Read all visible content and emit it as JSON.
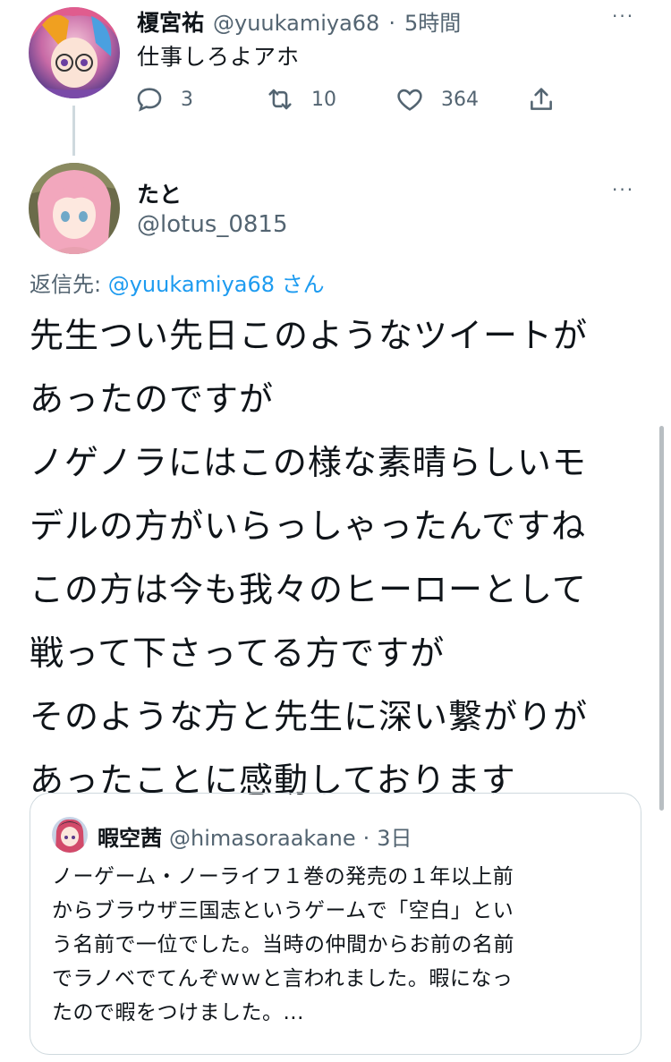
{
  "parent_tweet": {
    "name": "榎宮祐",
    "handle": "@yuukamiya68",
    "separator": "·",
    "time": "5時間",
    "text": "仕事しろよアホ",
    "replies": "3",
    "retweets": "10",
    "likes": "364",
    "more": "···"
  },
  "reply_tweet": {
    "name": "たと",
    "handle": "@lotus_0815",
    "more": "···",
    "reply_to_prefix": "返信先: ",
    "reply_to_handle": "@yuukamiya68",
    "reply_to_suffix": " さん",
    "lines": [
      "先生つい先日このようなツイートが",
      "あったのですが",
      "ノゲノラにはこの様な素晴らしいモ",
      "デルの方がいらっしゃったんですね",
      "この方は今も我々のヒーローとして",
      "戦って下さってる方ですが",
      "そのような方と先生に深い繋がりが",
      "あったことに感動しております"
    ]
  },
  "quoted_tweet": {
    "name": "暇空茜",
    "handle": "@himasoraakane",
    "separator": "·",
    "time": "3日",
    "lines": [
      "ノーゲーム・ノーライフ１巻の発売の１年以上前",
      "からブラウザ三国志というゲームで「空白」とい",
      "う名前で一位でした。当時の仲間からお前の名前",
      "でラノベでてんぞｗｗと言われました。暇になっ",
      "たので暇をつけました。..."
    ]
  },
  "icons": [
    "reply-icon",
    "retweet-icon",
    "like-icon",
    "share-icon",
    "more-icon"
  ],
  "colors": {
    "link": "#1d9bf0",
    "muted": "#536471",
    "border": "#cfd9de"
  }
}
